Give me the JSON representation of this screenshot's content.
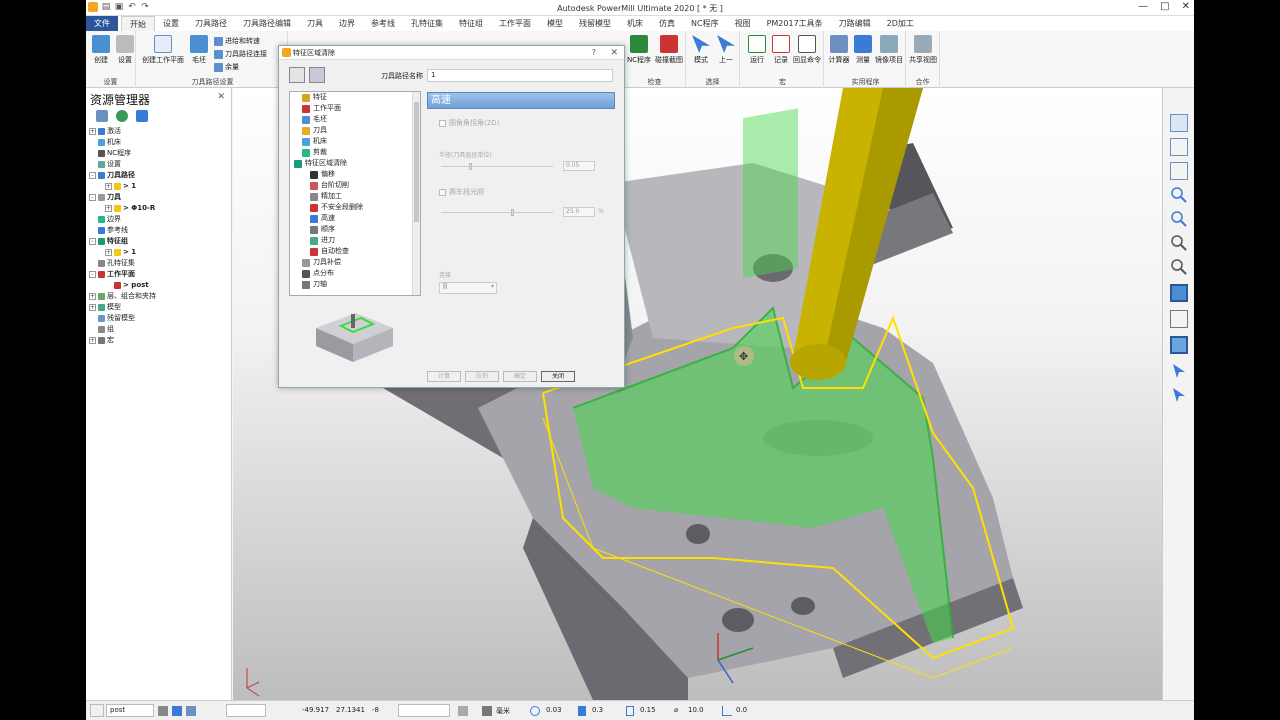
{
  "window": {
    "title": "Autodesk PowerMill Ultimate 2020 [ * 无 ]",
    "min": "—",
    "max": "□",
    "close": "✕"
  },
  "menu_tabs": [
    "文件",
    "开始",
    "设置",
    "刀具路径",
    "刀具路径编辑",
    "刀具",
    "边界",
    "参考线",
    "孔特征集",
    "特征组",
    "工作平面",
    "模型",
    "残留模型",
    "机床",
    "仿真",
    "NC程序",
    "视图",
    "PM2017工具条",
    "刀路编辑",
    "2D加工"
  ],
  "ribbon": {
    "groups": {
      "settings": "设置",
      "toolpath_setup": "刀具路径设置",
      "check": "检查",
      "select": "选择",
      "macro": "宏",
      "utility": "实用程序",
      "collab": "合作"
    },
    "buttons": {
      "create": "创建",
      "settings": "设置",
      "create_workplane": "创建工作平面",
      "stock": "毛坯",
      "leads": "进给和转速",
      "tp_connect": "刀具路径连接",
      "stock_allow": "余量",
      "nc_program": "NC程序",
      "collision": "碰撞截图",
      "mode": "模式",
      "previous": "上一",
      "run": "运行",
      "record": "记录",
      "echo": "回显命令",
      "calculator": "计算器",
      "measure": "测量",
      "mirror": "镜像项目",
      "share_view": "共享视图",
      "create_cut": "创"
    }
  },
  "explorer": {
    "title": "资源管理器",
    "close": "✕",
    "tree": [
      {
        "label": "激活",
        "pm": "+",
        "color": "#3a7bd5",
        "bold": false,
        "indent": 0
      },
      {
        "label": "机床",
        "pm": "",
        "color": "#4aa3df",
        "bold": false,
        "indent": 0
      },
      {
        "label": "NC程序",
        "pm": "",
        "color": "#555",
        "bold": false,
        "indent": 0
      },
      {
        "label": "设置",
        "pm": "",
        "color": "#5a9",
        "bold": false,
        "indent": 0
      },
      {
        "label": "刀具路径",
        "pm": "-",
        "color": "#3a7bd5",
        "bold": true,
        "indent": 0
      },
      {
        "label": "> 1",
        "pm": "+",
        "color": "#f5c518",
        "bold": true,
        "indent": 2
      },
      {
        "label": "刀具",
        "pm": "-",
        "color": "#999",
        "bold": true,
        "indent": 0
      },
      {
        "label": "> Φ10-R",
        "pm": "+",
        "color": "#f5c518",
        "bold": true,
        "indent": 2
      },
      {
        "label": "边界",
        "pm": "",
        "color": "#2b8",
        "bold": false,
        "indent": 0
      },
      {
        "label": "参考线",
        "pm": "",
        "color": "#3a7bd5",
        "bold": false,
        "indent": 0
      },
      {
        "label": "特征组",
        "pm": "-",
        "color": "#1a9a7a",
        "bold": true,
        "indent": 0
      },
      {
        "label": "> 1",
        "pm": "+",
        "color": "#f5c518",
        "bold": true,
        "indent": 2
      },
      {
        "label": "孔特征集",
        "pm": "",
        "color": "#888",
        "bold": false,
        "indent": 0
      },
      {
        "label": "工作平面",
        "pm": "-",
        "color": "#c33",
        "bold": true,
        "indent": 0
      },
      {
        "label": "> post",
        "pm": "",
        "color": "#c33",
        "bold": true,
        "indent": 2
      },
      {
        "label": "层、组合和夹持",
        "pm": "+",
        "color": "#6a6",
        "bold": false,
        "indent": 0
      },
      {
        "label": "模型",
        "pm": "+",
        "color": "#4a8",
        "bold": false,
        "indent": 0
      },
      {
        "label": "残留模型",
        "pm": "",
        "color": "#69c",
        "bold": false,
        "indent": 0
      },
      {
        "label": "组",
        "pm": "",
        "color": "#888",
        "bold": false,
        "indent": 0
      },
      {
        "label": "宏",
        "pm": "+",
        "color": "#777",
        "bold": false,
        "indent": 0
      }
    ]
  },
  "dialog": {
    "title": "特征区域清除",
    "help": "?",
    "close": "✕",
    "name_label": "刀具路径名称",
    "name_value": "1",
    "tree": [
      {
        "label": "特征",
        "color": "#d7a22a",
        "indent": 1
      },
      {
        "label": "工作平面",
        "color": "#c33",
        "indent": 1
      },
      {
        "label": "毛坯",
        "color": "#4a8fd0",
        "indent": 1
      },
      {
        "label": "刀具",
        "color": "#e0b020",
        "indent": 1
      },
      {
        "label": "机床",
        "color": "#4aa3df",
        "indent": 1
      },
      {
        "label": "剪裁",
        "color": "#2b8",
        "indent": 1
      },
      {
        "label": "特征区域清除",
        "color": "#1a9a7a",
        "indent": 0
      },
      {
        "label": "偏移",
        "color": "#333",
        "indent": 2
      },
      {
        "label": "台阶切削",
        "color": "#c55",
        "indent": 2
      },
      {
        "label": "精加工",
        "color": "#888",
        "indent": 2
      },
      {
        "label": "不安全段删除",
        "color": "#c33",
        "indent": 2
      },
      {
        "label": "高速",
        "color": "#3a7bd5",
        "indent": 2
      },
      {
        "label": "顺序",
        "color": "#777",
        "indent": 2
      },
      {
        "label": "进刀",
        "color": "#4a8",
        "indent": 2
      },
      {
        "label": "自动检查",
        "color": "#c33",
        "indent": 2
      },
      {
        "label": "刀具补偿",
        "color": "#999",
        "indent": 1
      },
      {
        "label": "点分布",
        "color": "#555",
        "indent": 1
      },
      {
        "label": "刀轴",
        "color": "#777",
        "indent": 1
      }
    ],
    "panel_title": "高速",
    "fields": {
      "corner_label": "圆角角拐角(2D)",
      "radius_label": "半径(刀具直径单位)",
      "radius_value": "0.05",
      "smooth_label": "赛车线光顺",
      "smooth_value": "25.0",
      "smooth_unit": "%",
      "dir_label": "连接",
      "dir_value": "直"
    },
    "buttons": {
      "calc": "计算",
      "queue": "队列",
      "ok": "确定",
      "close": "关闭"
    }
  },
  "status": {
    "workplane": "post",
    "x": "-49.917",
    "y": "27.1341",
    "z": "-8",
    "unit": "毫米",
    "tol": "0.03",
    "thick": "0.3",
    "stepover": "0.15",
    "dia": "10.0",
    "angle": "0.0"
  },
  "colors": {
    "accent": "#2b579a",
    "toolpath": "#3ddc3d",
    "tool": "#c8b400",
    "block": "#9a9aa0",
    "boundary": "#ffe000"
  }
}
